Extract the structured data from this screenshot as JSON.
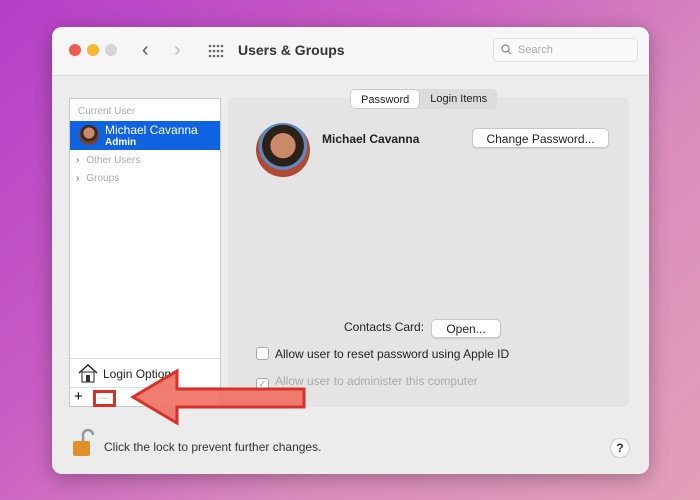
{
  "window": {
    "title": "Users & Groups",
    "search_placeholder": "Search"
  },
  "sidebar": {
    "section": "Current User",
    "current_user": {
      "name": "Michael Cavanna",
      "role": "Admin"
    },
    "groups": [
      "Other Users",
      "Groups"
    ],
    "login_options": "Login Options",
    "add": "+",
    "remove": "—"
  },
  "tabs": [
    "Password",
    "Login Items"
  ],
  "user": {
    "name": "Michael Cavanna",
    "change_password": "Change Password..."
  },
  "contacts": {
    "label": "Contacts Card:",
    "button": "Open..."
  },
  "options": [
    {
      "label": "Allow user to reset password using Apple ID",
      "checked": false,
      "enabled": true
    },
    {
      "label": "Allow user to administer this computer",
      "checked": true,
      "enabled": false
    }
  ],
  "footer": {
    "lock_text": "Click the lock to prevent further changes.",
    "help": "?"
  },
  "colors": {
    "accent": "#1063e0",
    "annotation": "#d9302a"
  }
}
